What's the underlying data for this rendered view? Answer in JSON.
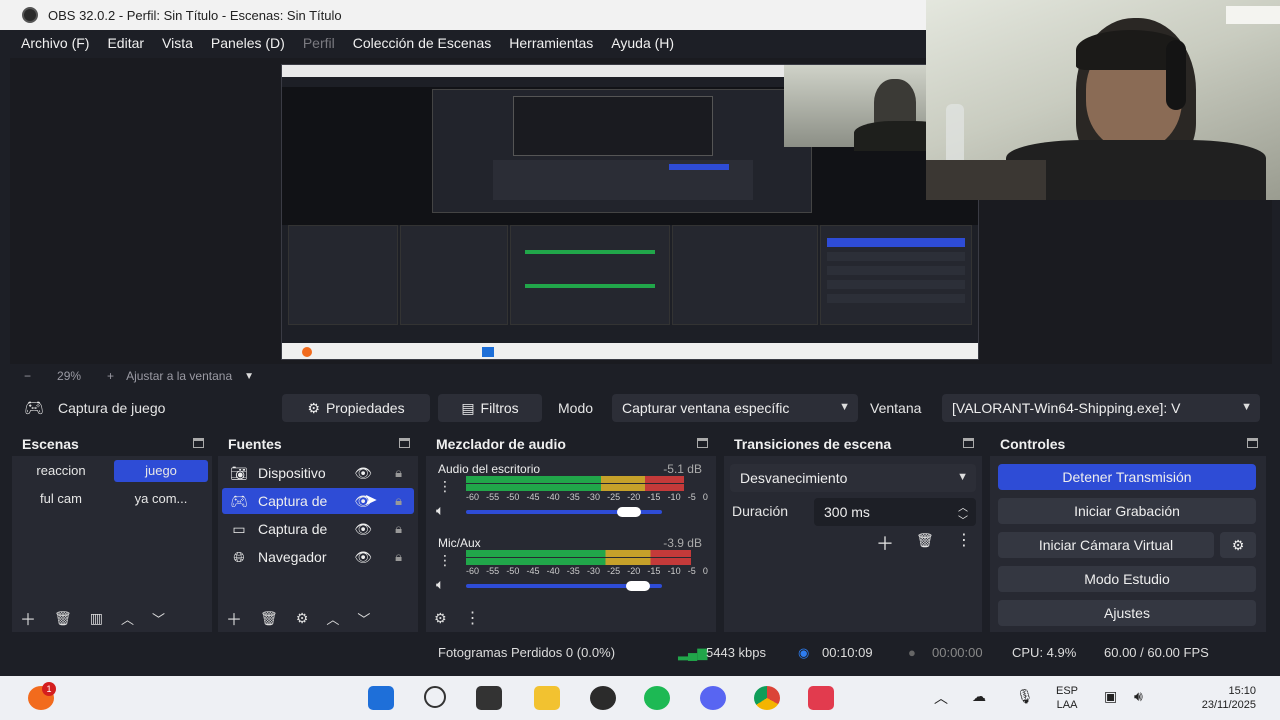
{
  "window": {
    "title": "OBS 32.0.2 - Perfil: Sin Título - Escenas: Sin Título"
  },
  "menu": {
    "items": [
      "Archivo (F)",
      "Editar",
      "Vista",
      "Paneles (D)",
      "Perfil",
      "Colección de Escenas",
      "Herramientas",
      "Ayuda (H)"
    ],
    "disabled_index": 4
  },
  "zoom": {
    "minus": "−",
    "value": "29%",
    "plus": "+",
    "fit_label": "Ajustar a la ventana",
    "chevron": "⌄"
  },
  "source_toolbar": {
    "icon": "gamepad-icon",
    "current_source": "Captura de juego",
    "properties_label": "Propiedades",
    "filters_label": "Filtros",
    "mode_label": "Modo",
    "mode_value": "Capturar ventana específic",
    "window_label": "Ventana",
    "window_value": "[VALORANT-Win64-Shipping.exe]: V"
  },
  "scenes": {
    "title": "Escenas",
    "items": [
      "reaccion",
      "juego",
      "ful cam",
      "ya com..."
    ],
    "active": "juego"
  },
  "sources": {
    "title": "Fuentes",
    "items": [
      {
        "icon": "camera-icon",
        "label": "Dispositivo"
      },
      {
        "icon": "gamepad-icon",
        "label": "Captura de"
      },
      {
        "icon": "monitor-icon",
        "label": "Captura de"
      },
      {
        "icon": "globe-icon",
        "label": "Navegador"
      }
    ],
    "selected_index": 1
  },
  "mixer": {
    "title": "Mezclador de audio",
    "scale": [
      "-60",
      "-55",
      "-50",
      "-45",
      "-40",
      "-35",
      "-30",
      "-25",
      "-20",
      "-15",
      "-10",
      "-5",
      "0"
    ],
    "channels": [
      {
        "name": "Audio del escritorio",
        "db": "-5.1 dB",
        "level": 0.9,
        "volume": 0.83
      },
      {
        "name": "Mic/Aux",
        "db": "-3.9 dB",
        "level": 0.93,
        "volume": 0.88
      }
    ]
  },
  "transitions": {
    "title": "Transiciones de escena",
    "transition": "Desvanecimiento",
    "duration_label": "Duración",
    "duration_value": "300 ms"
  },
  "controls": {
    "title": "Controles",
    "stop_stream": "Detener Transmisión",
    "start_recording": "Iniciar Grabación",
    "start_virtualcam": "Iniciar Cámara Virtual",
    "studio_mode": "Modo Estudio",
    "settings": "Ajustes"
  },
  "status": {
    "dropped_frames": "Fotogramas Perdidos 0 (0.0%)",
    "bitrate": "5443 kbps",
    "stream_time": "00:10:09",
    "record_time": "00:00:00",
    "cpu": "CPU: 4.9%",
    "fps": "60.00 / 60.00 FPS"
  },
  "taskbar": {
    "notification_count": "1",
    "language": "ESP",
    "region": "LAA",
    "time": "15:10",
    "date": "23/11/2025"
  },
  "colors": {
    "accent": "#2e4cd6",
    "background": "#1d1f26",
    "panel": "#272932",
    "meter_green": "#21a64a",
    "meter_yellow": "#c6a12a",
    "meter_red": "#c43a3a"
  }
}
